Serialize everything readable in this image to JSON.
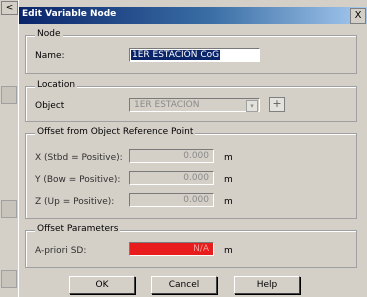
{
  "background": {
    "button_label": "<"
  },
  "dialog": {
    "title": "Edit Variable Node",
    "close_label": "X"
  },
  "node_group": {
    "legend": "Node",
    "name_label": "Name:",
    "name_value": "1ER ESTACION CoG"
  },
  "location_group": {
    "legend": "Location",
    "object_label": "Object",
    "object_value": "1ER ESTACION",
    "combo_arrow_label": "▾",
    "browse_label": "+"
  },
  "offset_group": {
    "legend": "Offset from Object Reference Point",
    "rows": [
      {
        "label": "X (Stbd = Positive):",
        "value": "0.000",
        "unit": "m"
      },
      {
        "label": "Y (Bow = Positive):",
        "value": "0.000",
        "unit": "m"
      },
      {
        "label": "Z (Up = Positive):",
        "value": "0.000",
        "unit": "m"
      }
    ]
  },
  "params_group": {
    "legend": "Offset Parameters",
    "apriori_label": "A-priori SD:",
    "apriori_value": "N/A",
    "apriori_unit": "m"
  },
  "buttons": {
    "ok": "OK",
    "cancel": "Cancel",
    "help": "Help"
  },
  "colors": {
    "titlebar_start": "#0a246a",
    "titlebar_end": "#a6caf0",
    "dialog_face": "#d4d0c8",
    "apriori_field": "#e81c1c"
  }
}
